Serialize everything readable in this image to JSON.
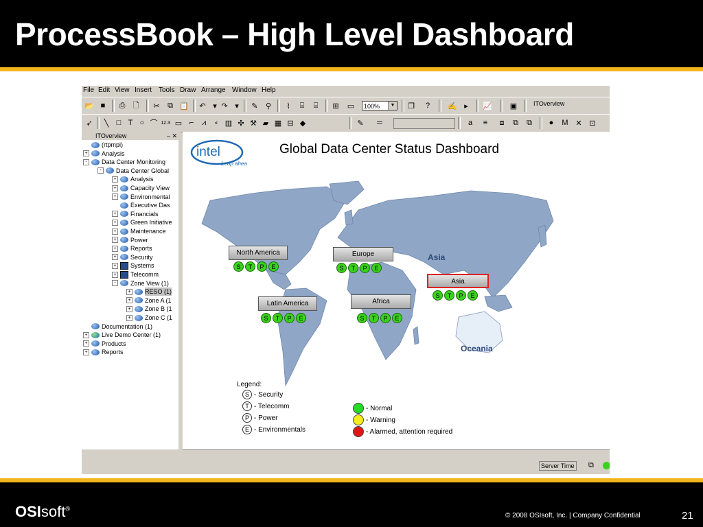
{
  "slide": {
    "title": "ProcessBook – High Level Dashboard",
    "footer_brand_bold": "OSI",
    "footer_brand_rest": "soft",
    "footer_copyright": "© 2008 OSIsoft, Inc.  |  Company Confidential",
    "page_number": "21",
    "accent_color": "#f2b61c"
  },
  "app": {
    "menu": [
      "File",
      "Edit",
      "View",
      "Insert",
      "Tools",
      "Draw",
      "Arrange",
      "Window",
      "Help"
    ],
    "zoom_value": "100%",
    "toolbar_display_name": "ITOverview",
    "tree": {
      "panel_title": "ITOverview",
      "items": [
        {
          "label": "(rtpmpi)",
          "depth": 0,
          "expander": "",
          "icon": "database-icon"
        },
        {
          "label": "Analysis",
          "depth": 0,
          "expander": "+",
          "icon": "database-icon"
        },
        {
          "label": "Data Center Monitoring",
          "depth": 0,
          "expander": "-",
          "icon": "database-icon"
        },
        {
          "label": "Data Center Global",
          "depth": 1,
          "expander": "-",
          "icon": "database-icon"
        },
        {
          "label": "Analysis",
          "depth": 2,
          "expander": "+",
          "icon": "database-icon"
        },
        {
          "label": "Capacity View",
          "depth": 2,
          "expander": "+",
          "icon": "database-icon"
        },
        {
          "label": "Environmental",
          "depth": 2,
          "expander": "+",
          "icon": "database-icon"
        },
        {
          "label": "Executive Das",
          "depth": 2,
          "expander": "",
          "icon": "database-icon"
        },
        {
          "label": "Financials",
          "depth": 2,
          "expander": "+",
          "icon": "database-icon"
        },
        {
          "label": "Green Initiative",
          "depth": 2,
          "expander": "+",
          "icon": "database-icon"
        },
        {
          "label": "Maintenance",
          "depth": 2,
          "expander": "+",
          "icon": "database-icon"
        },
        {
          "label": "Power",
          "depth": 2,
          "expander": "+",
          "icon": "database-icon"
        },
        {
          "label": "Reports",
          "depth": 2,
          "expander": "+",
          "icon": "database-icon"
        },
        {
          "label": "Security",
          "depth": 2,
          "expander": "+",
          "icon": "database-icon"
        },
        {
          "label": "Systems",
          "depth": 2,
          "expander": "+",
          "icon": "computer-icon"
        },
        {
          "label": "Telecomm",
          "depth": 2,
          "expander": "+",
          "icon": "computer-icon"
        },
        {
          "label": "Zone View (1)",
          "depth": 2,
          "expander": "-",
          "icon": "database-icon"
        },
        {
          "label": "RESO (1)",
          "depth": 3,
          "expander": "+",
          "icon": "database-icon",
          "selected": true
        },
        {
          "label": "Zone A (1",
          "depth": 3,
          "expander": "+",
          "icon": "database-icon"
        },
        {
          "label": "Zone B (1",
          "depth": 3,
          "expander": "+",
          "icon": "database-icon"
        },
        {
          "label": "Zone C (1",
          "depth": 3,
          "expander": "+",
          "icon": "database-icon"
        },
        {
          "label": "Documentation (1)",
          "depth": 0,
          "expander": "",
          "icon": "database-icon"
        },
        {
          "label": "Live Demo Center (1)",
          "depth": 0,
          "expander": "+",
          "icon": "globe-icon"
        },
        {
          "label": "Products",
          "depth": 0,
          "expander": "+",
          "icon": "database-icon"
        },
        {
          "label": "Reports",
          "depth": 0,
          "expander": "+",
          "icon": "database-icon"
        }
      ]
    },
    "status_server_time": "Server Time"
  },
  "dashboard": {
    "logo_text": "intel",
    "logo_tagline": "Leap ahead",
    "title": "Global Data Center Status Dashboard",
    "map_labels": {
      "asia": "Asia",
      "oceania": "Oceania"
    },
    "regions": [
      {
        "key": "north_america",
        "name": "North America",
        "alert": false
      },
      {
        "key": "europe",
        "name": "Europe",
        "alert": false
      },
      {
        "key": "asia",
        "name": "Asia",
        "alert": true
      },
      {
        "key": "latin_america",
        "name": "Latin America",
        "alert": false
      },
      {
        "key": "africa",
        "name": "Africa",
        "alert": false
      }
    ],
    "status_letters": [
      "S",
      "T",
      "P",
      "E"
    ],
    "legend": {
      "title": "Legend:",
      "letters": [
        {
          "letter": "S",
          "text": "- Security"
        },
        {
          "letter": "T",
          "text": "- Telecomm"
        },
        {
          "letter": "P",
          "text": "- Power"
        },
        {
          "letter": "E",
          "text": "- Environmentals"
        }
      ],
      "colors": [
        {
          "color": "#22dd22",
          "text": "- Normal"
        },
        {
          "color": "#f5ee1a",
          "text": "- Warning"
        },
        {
          "color": "#e01515",
          "text": "- Alarmed, attention required"
        }
      ]
    }
  }
}
